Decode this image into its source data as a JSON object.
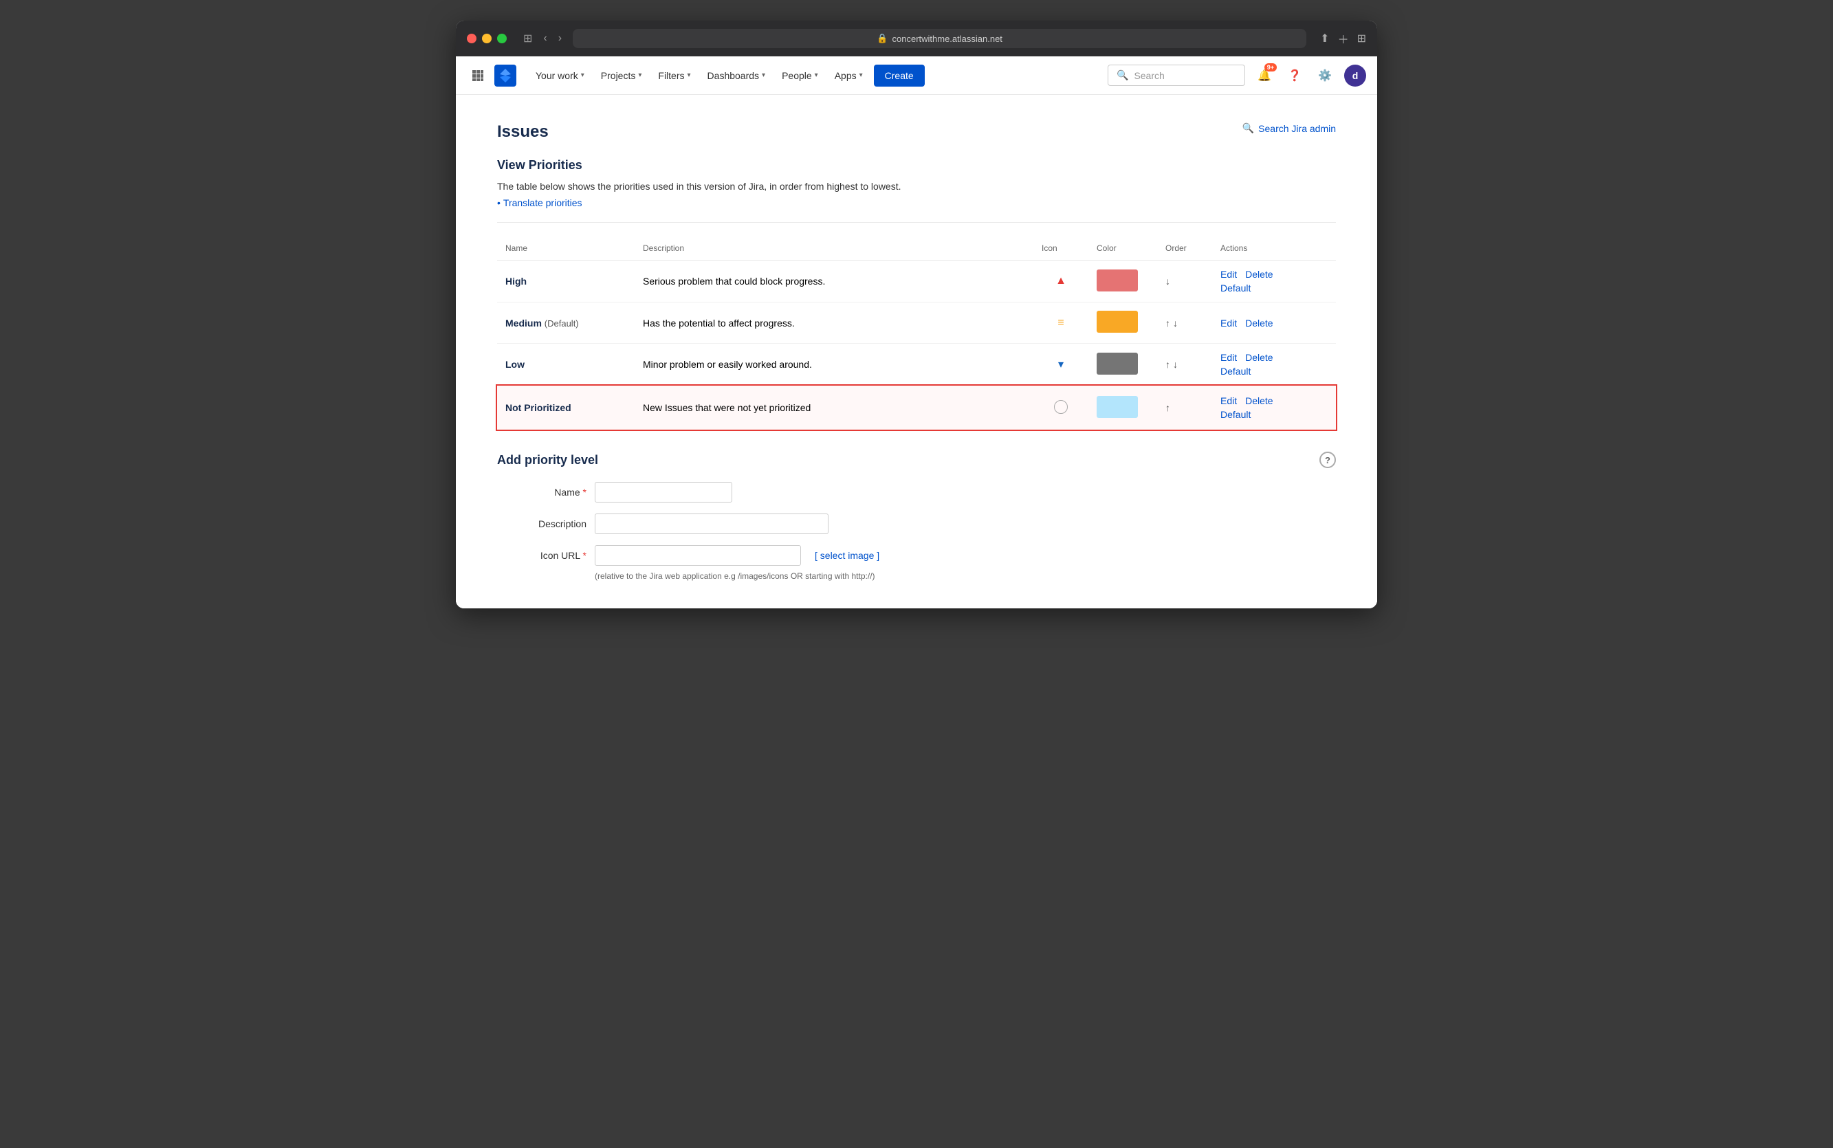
{
  "browser": {
    "url": "concertwithme.atlassian.net",
    "lock_icon": "🔒"
  },
  "nav": {
    "your_work": "Your work",
    "projects": "Projects",
    "filters": "Filters",
    "dashboards": "Dashboards",
    "people": "People",
    "apps": "Apps",
    "create": "Create",
    "search_placeholder": "Search",
    "notification_badge": "9+",
    "avatar_letter": "d"
  },
  "page": {
    "title": "Issues",
    "search_admin": "Search Jira admin",
    "view_priorities_title": "View Priorities",
    "description": "The table below shows the priorities used in this version of Jira, in order from highest to lowest.",
    "translate_link": "Translate priorities"
  },
  "table": {
    "headers": {
      "name": "Name",
      "description": "Description",
      "icon": "Icon",
      "color": "Color",
      "order": "Order",
      "actions": "Actions"
    },
    "rows": [
      {
        "name": "High",
        "default": false,
        "description": "Serious problem that could block progress.",
        "icon_type": "chevron_up",
        "color": "#e57373",
        "order_options": [
          "down"
        ],
        "actions": [
          "Edit",
          "Delete",
          "Default"
        ]
      },
      {
        "name": "Medium",
        "default": true,
        "default_label": "(Default)",
        "description": "Has the potential to affect progress.",
        "icon_type": "equals",
        "color": "#f9a825",
        "order_options": [
          "up",
          "down"
        ],
        "actions": [
          "Edit",
          "Delete"
        ]
      },
      {
        "name": "Low",
        "default": false,
        "description": "Minor problem or easily worked around.",
        "icon_type": "chevron_down",
        "color": "#757575",
        "order_options": [
          "up",
          "down"
        ],
        "actions": [
          "Edit",
          "Delete",
          "Default"
        ]
      },
      {
        "name": "Not Prioritized",
        "default": false,
        "description": "New Issues that were not yet prioritized",
        "icon_type": "circle",
        "color": "#b3e5fc",
        "order_options": [
          "up"
        ],
        "actions": [
          "Edit",
          "Delete",
          "Default"
        ],
        "highlighted": true
      }
    ]
  },
  "add_priority": {
    "title": "Add priority level",
    "name_label": "Name",
    "description_label": "Description",
    "icon_url_label": "Icon URL",
    "required_marker": "*",
    "select_image": "[ select image ]",
    "icon_hint": "(relative to the Jira web application e.g /images/icons OR starting with http://)"
  }
}
